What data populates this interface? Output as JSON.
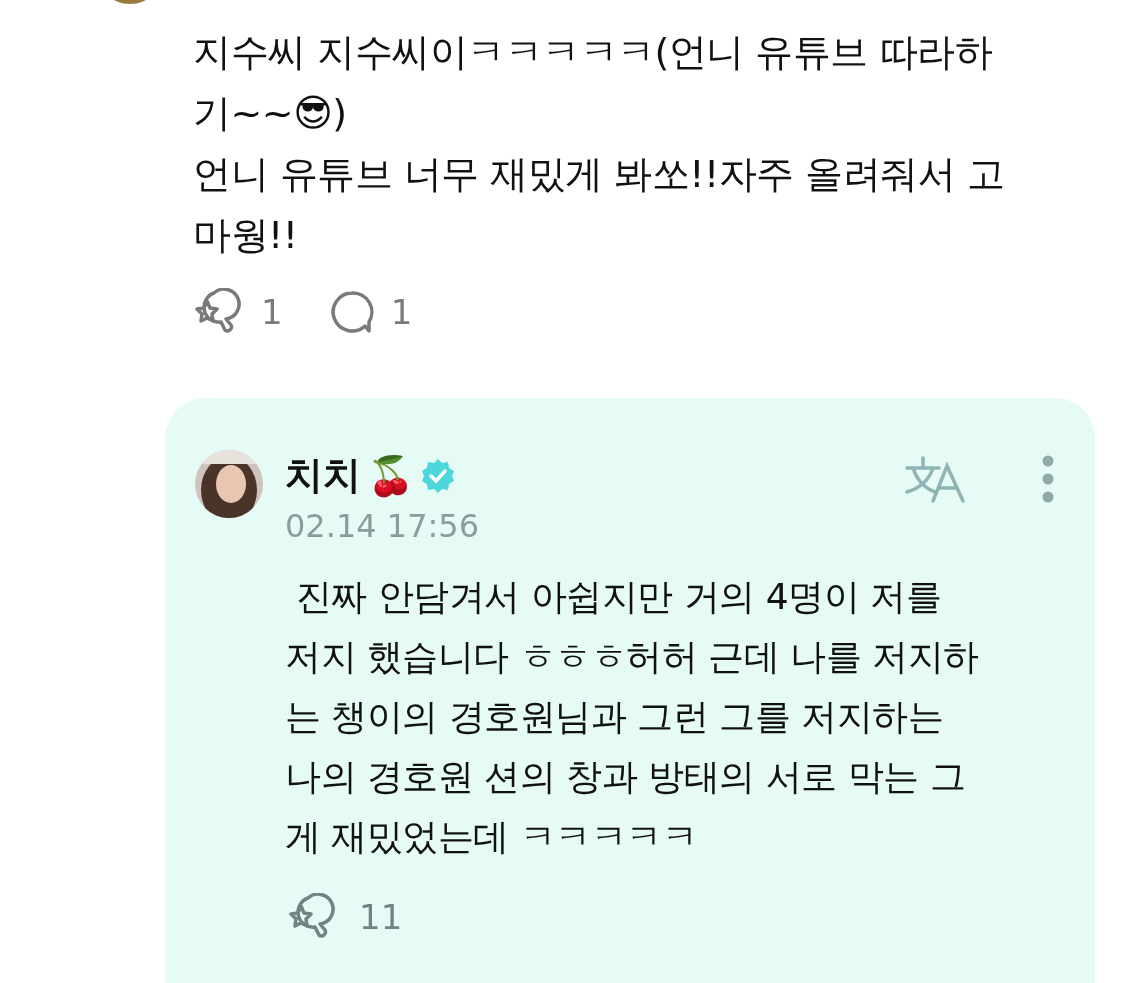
{
  "comment": {
    "lines": [
      "지수씨 지수씨이ㅋㅋㅋㅋㅋ(언니 유튜브 따라하",
      "기~~😎)",
      "언니 유튜브 너무 재밌게 봐쏘!!자주 올려줘서 고",
      "마웡!!"
    ],
    "likes": "1",
    "replies": "1"
  },
  "reply": {
    "name": "치치",
    "name_emoji": "🍒",
    "verified": true,
    "date": "02.14 17:56",
    "lines": [
      " 진짜 안담겨서 아쉽지만 거의 4명이 저를",
      "저지 했습니다 ㅎㅎㅎ허허 근데 나를 저지하",
      "는 챙이의 경호원님과 그런 그를 저지하는",
      "나의 경호원 션의 창과 방태의 서로 막는 그",
      "게 재밌었는데 ㅋㅋㅋㅋㅋ"
    ],
    "likes": "11"
  }
}
